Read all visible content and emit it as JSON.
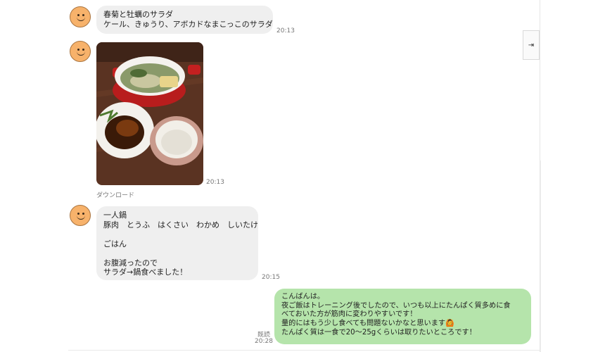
{
  "messages": [
    {
      "text": "春菊と牡蠣のサラダ\nケール、きゅうり、アボカドなまこっこのサラダ",
      "time": "20:13"
    },
    {
      "time": "20:13",
      "download_label": "ダウンロード"
    },
    {
      "text": "一人鍋\n豚肉　とうふ　はくさい　わかめ　しいたけ\n\nごはん\n\nお腹減ったので\nサラダ→鍋食べました！",
      "time": "20:15"
    },
    {
      "text": "こんばんは。\n夜ご飯はトレーニング後でしたので、いつも以上にたんぱく質多めに食\nべておいた方が筋肉に変わりやすいです！\n量的にはもう少し食べても問題ないかなと思います🙆\nたんぱく質は一食で20〜25gくらいは取りたいところです！",
      "time": "20:28",
      "read": "既読"
    }
  ],
  "side_button": {
    "icon": "expand-panel-icon",
    "glyph": "⇥"
  },
  "colors": {
    "incoming_bubble": "#efefef",
    "outgoing_bubble": "#b5e4ab",
    "avatar": "#f7b26b"
  }
}
